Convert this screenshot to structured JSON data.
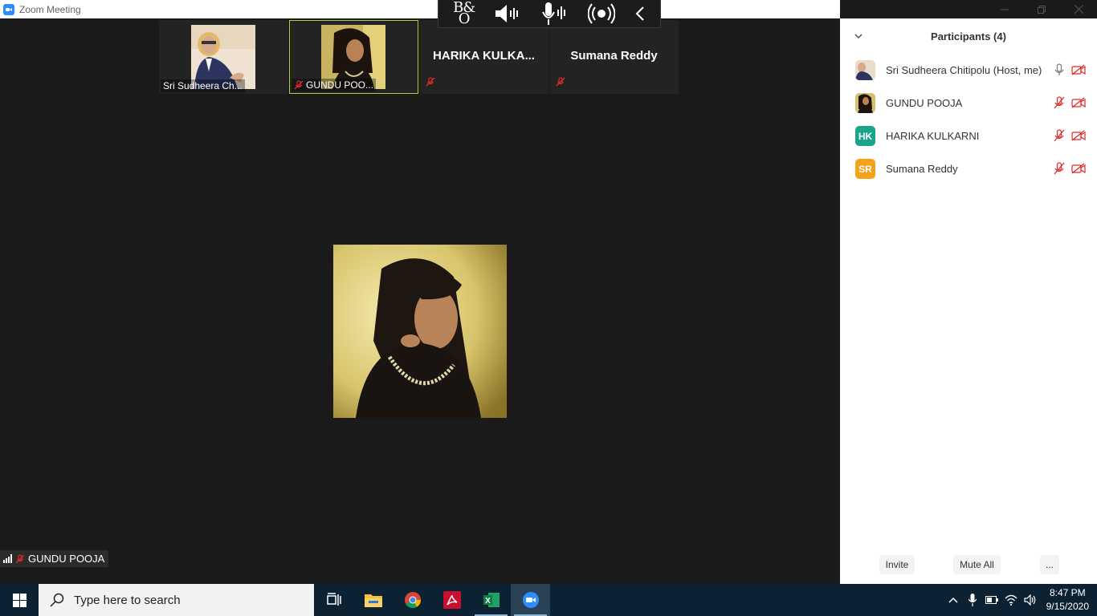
{
  "window": {
    "title": "Zoom Meeting"
  },
  "floating_toolbar": {
    "brand_top": "B&",
    "brand_bottom": "O"
  },
  "thumbnails": [
    {
      "name": "Sri Sudheera Ch...",
      "has_photo": true,
      "muted": false,
      "active": false
    },
    {
      "name": "GUNDU POO...",
      "has_photo": true,
      "muted": true,
      "active": true
    },
    {
      "name": "HARIKA KULKA...",
      "has_photo": false,
      "muted": true,
      "active": false
    },
    {
      "name": "Sumana Reddy",
      "has_photo": false,
      "muted": true,
      "active": false
    }
  ],
  "active_speaker": {
    "name": "GUNDU POOJA",
    "muted": true
  },
  "participants_panel": {
    "title": "Participants (4)",
    "participants": [
      {
        "name": "Sri Sudheera Chitipolu (Host, me)",
        "avatar": "photo",
        "avatar_color": "#9aa3c9",
        "mic": "on",
        "video": "off"
      },
      {
        "name": "GUNDU POOJA",
        "avatar": "photo",
        "avatar_color": "#b89a3a",
        "mic": "muted",
        "video": "off"
      },
      {
        "name": "HARIKA KULKARNI",
        "avatar": "HK",
        "avatar_color": "#1aa58b",
        "mic": "muted",
        "video": "off"
      },
      {
        "name": "Sumana Reddy",
        "avatar": "SR",
        "avatar_color": "#f5a21b",
        "mic": "muted",
        "video": "off"
      }
    ],
    "invite_label": "Invite",
    "mute_all_label": "Mute All",
    "more_label": "..."
  },
  "taskbar": {
    "search_placeholder": "Type here to search",
    "time": "8:47 PM",
    "date": "9/15/2020",
    "apps": [
      "task-view",
      "file-explorer",
      "chrome",
      "acrobat",
      "excel",
      "zoom"
    ]
  },
  "colors": {
    "stage_bg": "#1a1a1a",
    "active_border": "#a8d13e",
    "muted_red": "#e02828",
    "zoom_blue": "#2d8cff",
    "taskbar_bg": "#0c2233"
  }
}
